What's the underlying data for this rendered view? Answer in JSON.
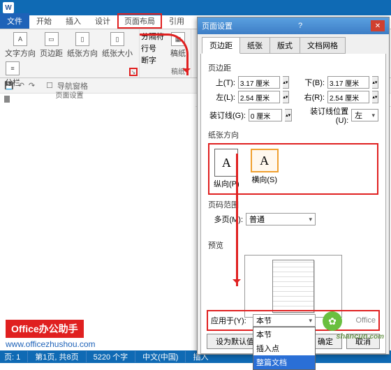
{
  "app_icon": "W",
  "tabs": {
    "file": "文件",
    "home": "开始",
    "insert": "插入",
    "design": "设计",
    "layout": "页面布局",
    "ref": "引用"
  },
  "ribbon": {
    "btns": {
      "direction": "文字方向",
      "margins": "页边距",
      "orient": "纸张方向",
      "size": "纸张大小",
      "columns": "分栏"
    },
    "small": {
      "breaks": "分隔符",
      "lineno": "行号",
      "hyphen": "断字"
    },
    "group_label": "页面设置",
    "paper": "稿纸",
    "paper_group": "稿纸"
  },
  "qat": {
    "nav": "导航窗格"
  },
  "dialog": {
    "title": "页面设置",
    "tabs": {
      "margins": "页边距",
      "paper": "纸张",
      "layout": "版式",
      "grid": "文档网格"
    },
    "section_margins": "页边距",
    "top": "上(T):",
    "top_v": "3.17 厘米",
    "bottom": "下(B):",
    "bottom_v": "3.17 厘米",
    "left": "左(L):",
    "left_v": "2.54 厘米",
    "right": "右(R):",
    "right_v": "2.54 厘米",
    "gutter": "装订线(G):",
    "gutter_v": "0 厘米",
    "gutter_pos": "装订线位置(U):",
    "gutter_pos_v": "左",
    "section_orient": "纸张方向",
    "portrait": "纵向(P)",
    "landscape": "横向(S)",
    "section_pages": "页码范围",
    "multi": "多页(M):",
    "multi_v": "普通",
    "section_preview": "预览",
    "apply": "应用于(Y):",
    "apply_v": "本节",
    "dd": {
      "o1": "本节",
      "o2": "插入点",
      "o3": "整篇文档"
    },
    "default_btn": "设为默认值",
    "ok": "确定",
    "cancel": "取消",
    "extra": "Office"
  },
  "brand": {
    "red": "Office办公助手",
    "url": "www.officezhushou.com"
  },
  "status": {
    "page": "页: 1",
    "pages": "第1页, 共8页",
    "words": "5220 个字",
    "lang": "中文(中国)",
    "ins": "插入"
  },
  "watermark": "shancun",
  "wm_sub": ".com"
}
